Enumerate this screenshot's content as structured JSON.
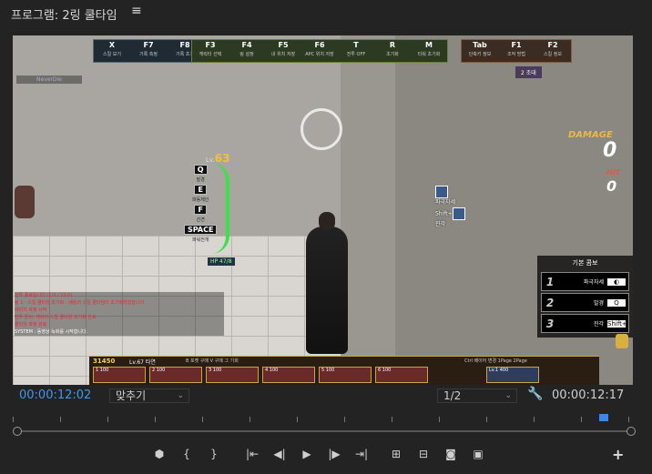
{
  "panel": {
    "title": "프로그램: 2링 쿨타임",
    "menu_icon": "≡"
  },
  "game": {
    "hotbar_left": [
      {
        "key": "X",
        "label": "스킬 보기"
      },
      {
        "key": "F7",
        "label": "기록 측정"
      },
      {
        "key": "F8",
        "label": "기록 초기"
      }
    ],
    "hotbar_mid": [
      {
        "key": "F3",
        "label": "캐릭터 선택"
      },
      {
        "key": "F4",
        "label": "링 설정"
      },
      {
        "key": "F5",
        "label": "내 위치 저장"
      },
      {
        "key": "F6",
        "label": "APC 위치 저장"
      },
      {
        "key": "T",
        "label": "전투 OFF"
      },
      {
        "key": "R",
        "label": "초기화"
      },
      {
        "key": "M",
        "label": "타워 초기화"
      }
    ],
    "hotbar_right": [
      {
        "key": "Tab",
        "label": "단축키 정보"
      },
      {
        "key": "F1",
        "label": "조작 방법"
      },
      {
        "key": "F2",
        "label": "스킬 정보"
      }
    ],
    "player_name": "NeverDie",
    "top_right_badge": "2 조대",
    "damage_label": "DAMAGE",
    "damage_value": "0",
    "hit_label": "HIT",
    "hit_value": "0",
    "level_prefix": "Lv.",
    "level": "63",
    "hp_text": "HP 47/8",
    "keys": [
      {
        "key": "Q",
        "label": "발경"
      },
      {
        "key": "E",
        "label": "파동체인"
      },
      {
        "key": "F",
        "label": "선견"
      },
      {
        "key": "SPACE",
        "label": "파워전개"
      }
    ],
    "chat_lines": [
      "전투 종료됩니다 (1:0 / 10:0)",
      "링 1 : 스킬 쿨타임 초기화 - 배틀러 스킬 쿨타임이 초기화되었습니다",
      "데미지 측정 시작",
      "전투 준비: 캐릭터 스킬 쿨타임 초기화 완료",
      "쿨타임 측정 완료"
    ],
    "system_line": "SYSTEM : 동영상 녹화를 시작합니다.",
    "right_skills": [
      {
        "name": "파극자세",
        "key": ""
      },
      {
        "name": "진각",
        "key": "Shift+"
      }
    ],
    "combo_panel": {
      "title": "기본 콤보",
      "rows": [
        {
          "num": "1",
          "name": "파극자세",
          "key": "◐"
        },
        {
          "num": "2",
          "name": "발경",
          "key": "Q"
        },
        {
          "num": "3",
          "name": "진각",
          "key": "Shift+"
        }
      ]
    },
    "gold": "31450",
    "char_level": "Lv.67 타연",
    "tabs_left": "B 포켓 구매   V 구매 그 기회",
    "tabs_right": "Ctrl 배이어 변경   1Page 2Page",
    "slots": [
      {
        "label": "1 100"
      },
      {
        "label": "2 100"
      },
      {
        "label": "3 100"
      },
      {
        "label": "4 100"
      },
      {
        "label": "5 100"
      },
      {
        "label": "6 100"
      }
    ],
    "slot_right": "Lv.1 400"
  },
  "controls": {
    "timecode_left": "00:00:12:02",
    "fit_label": "맞추기",
    "resolution_label": "1/2",
    "timecode_right": "00:00:12:17",
    "buttons": [
      {
        "icon": "marker-icon",
        "glyph": "⬢"
      },
      {
        "icon": "mark-in-icon",
        "glyph": "{"
      },
      {
        "icon": "mark-out-icon",
        "glyph": "}"
      },
      {
        "icon": "go-to-in-icon",
        "glyph": "|⇤"
      },
      {
        "icon": "step-back-icon",
        "glyph": "◀|"
      },
      {
        "icon": "play-icon",
        "glyph": "▶"
      },
      {
        "icon": "step-forward-icon",
        "glyph": "|▶"
      },
      {
        "icon": "go-to-out-icon",
        "glyph": "⇥|"
      },
      {
        "icon": "lift-icon",
        "glyph": "⊞"
      },
      {
        "icon": "extract-icon",
        "glyph": "⊟"
      },
      {
        "icon": "export-frame-icon",
        "glyph": "◙"
      },
      {
        "icon": "compare-view-icon",
        "glyph": "▣"
      }
    ],
    "add_button": "+"
  },
  "colors": {
    "timecode_accent": "#3b9be8",
    "hp_green": "#3ee04a",
    "gold": "#f2d16b"
  }
}
